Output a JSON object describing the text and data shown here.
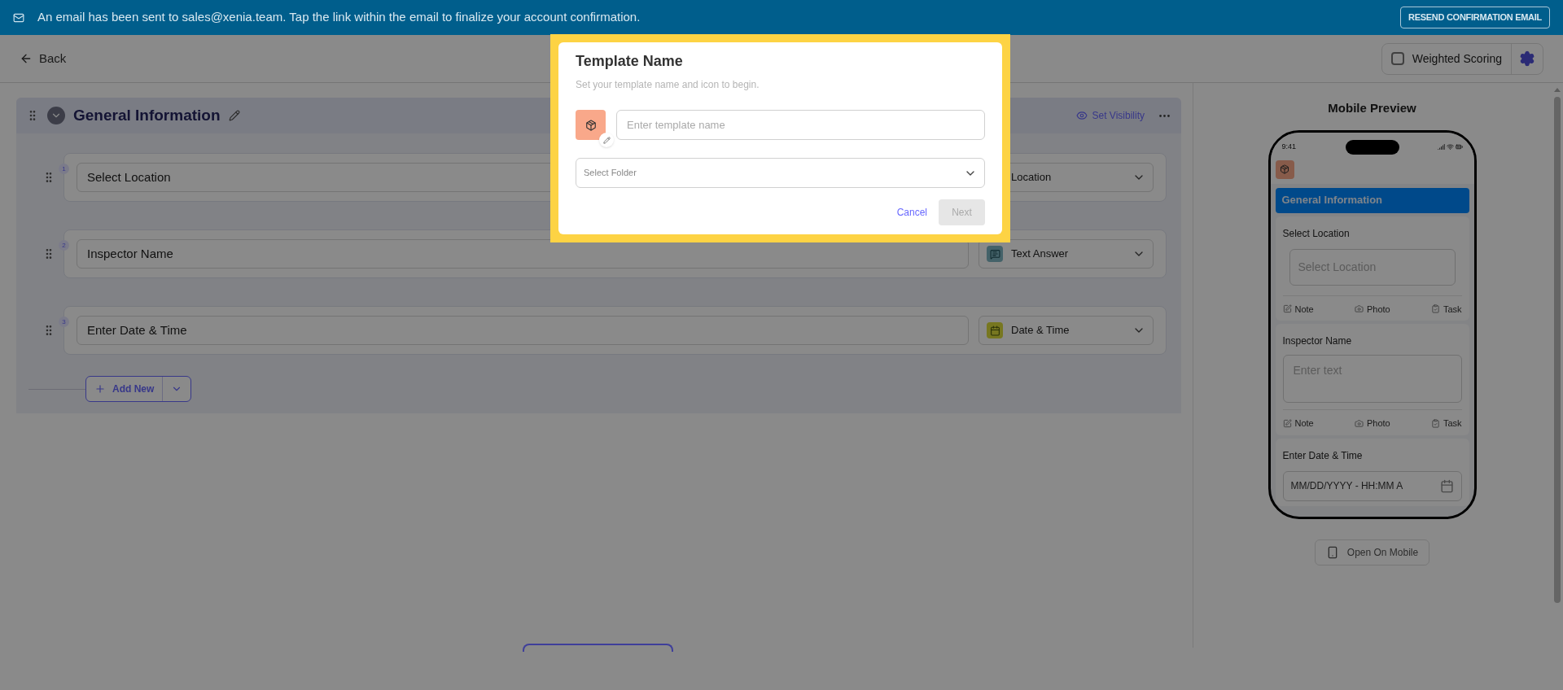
{
  "banner": {
    "message": "An email has been sent to sales@xenia.team. Tap the link within the email to finalize your account confirmation.",
    "button": "RESEND CONFIRMATION EMAIL"
  },
  "toolbar": {
    "back": "Back",
    "weighted_scoring": {
      "label": "Weighted Scoring",
      "checked": false
    }
  },
  "section": {
    "title": "General Information",
    "expanded": true,
    "visibility": "Set Visibility",
    "add_new": "Add New",
    "questions": [
      {
        "number": "1",
        "label": "Select Location",
        "type": "Location",
        "kind": "location"
      },
      {
        "number": "2",
        "label": "Inspector Name",
        "type": "Text Answer",
        "kind": "text"
      },
      {
        "number": "3",
        "label": "Enter Date & Time",
        "type": "Date & Time",
        "kind": "datetime"
      }
    ]
  },
  "mobile_preview": {
    "title": "Mobile Preview",
    "time": "9:41",
    "section_title": "General Information",
    "open_button": "Open On Mobile",
    "questions": [
      {
        "kind": "select",
        "label": "Select Location",
        "placeholder": "Select Location",
        "actions": [
          "Note",
          "Photo",
          "Task"
        ]
      },
      {
        "kind": "text",
        "label": "Inspector Name",
        "placeholder": "Enter text",
        "actions": [
          "Note",
          "Photo",
          "Task"
        ]
      },
      {
        "kind": "datetime",
        "label": "Enter Date & Time",
        "placeholder": "MM/DD/YYYY - HH:MM A"
      }
    ]
  },
  "dialog": {
    "title": "Template Name",
    "subtitle": "Set your template name and icon to begin.",
    "name_field": {
      "placeholder": "Enter template name"
    },
    "folder_select": {
      "placeholder": "Select Folder"
    },
    "cancel": "Cancel",
    "next": {
      "label": "Next",
      "disabled": true
    }
  }
}
